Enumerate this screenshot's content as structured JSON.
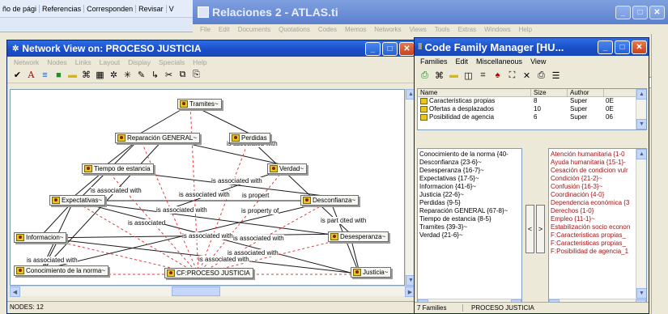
{
  "word_bg": {
    "ribbon_items": [
      "ño de pági",
      "Referencias",
      "Corresponden",
      "Revisar",
      "V"
    ]
  },
  "atlas_main": {
    "title": "Relaciones 2 - ATLAS.ti",
    "menu": [
      "File",
      "Edit",
      "Documents",
      "Quotations",
      "Codes",
      "Memos",
      "Networks",
      "Views",
      "Tools",
      "Extras",
      "Windows",
      "Help"
    ]
  },
  "network_view": {
    "title": "Network View on: PROCESO JUSTICIA",
    "menu": [
      "Network",
      "Nodes",
      "Links",
      "Layout",
      "Display",
      "Specials",
      "Help"
    ],
    "status": "NODES: 12",
    "nodes": {
      "tramites": "Tramites~",
      "reparacion": "Reparación GENERAL~",
      "perdidas": "Perdidas",
      "tiempo": "Tiempo de estancia",
      "verdad": "Verdad~",
      "expectativas": "Expectativas~",
      "desconfianza": "Desconfianza~",
      "informacion": "Informacion~",
      "desesperanza": "Desesperanza~",
      "conocimiento": "Conocimiento de la norma~",
      "cf_proceso": "CF:PROCESO JUSTICIA",
      "justicia": "Justicia~"
    },
    "relations": [
      "is associated with",
      "is associated with",
      "is associated with",
      "is associated with",
      "is propert",
      "is associated with",
      "is property of",
      "is associated",
      "is part of",
      "ited with",
      "is associated with",
      "is associated with",
      "is associated with",
      "is associated with",
      "is associated with"
    ]
  },
  "code_family": {
    "title": "Code Family Manager [HU...",
    "menu": [
      "Families",
      "Edit",
      "Miscellaneous",
      "View"
    ],
    "table_headers": [
      "Name",
      "Size",
      "Author"
    ],
    "families": [
      {
        "name": "Caracteristicas propias",
        "size": "8",
        "author": "Super",
        "extra": "0E"
      },
      {
        "name": "Ofertas a desplazados",
        "size": "10",
        "author": "Super",
        "extra": "0E"
      },
      {
        "name": "Posibilidad de agencia",
        "size": "6",
        "author": "Super",
        "extra": "06"
      }
    ],
    "members": [
      "Conocimiento de la norma {40-",
      "Desconfianza {23-6}~",
      "Desesperanza {16-7}~",
      "Expectativas {17-5}~",
      "Informacion {41-6}~",
      "Justicia {22-6}~",
      "Perdidas {9-5}",
      "Reparación GENERAL {67-8}~",
      "Tiempo de estancia {8-5}",
      "Tramites {39-3}~",
      "Verdad {21-6}~"
    ],
    "non_members": [
      "Atención humanitaria {1-0",
      "Ayuda humanitaria {15-1}-",
      "Cesación de condicion vulr",
      "Condición {21-2}~",
      "Confusión {16-3}~",
      "Coordinación {4-0}",
      "Dependencia económica {3",
      "Derechos {1-0}",
      "Empleo {11-1}~",
      "Estabilización socio econon",
      "F:Caracteristicas propias_",
      "F:Caracteristicas propias_",
      "F:Posibilidad de agencia_1"
    ],
    "move_left": "<",
    "move_right": ">",
    "status_count": "7 Families",
    "status_selected": "PROCESO JUSTICIA"
  }
}
